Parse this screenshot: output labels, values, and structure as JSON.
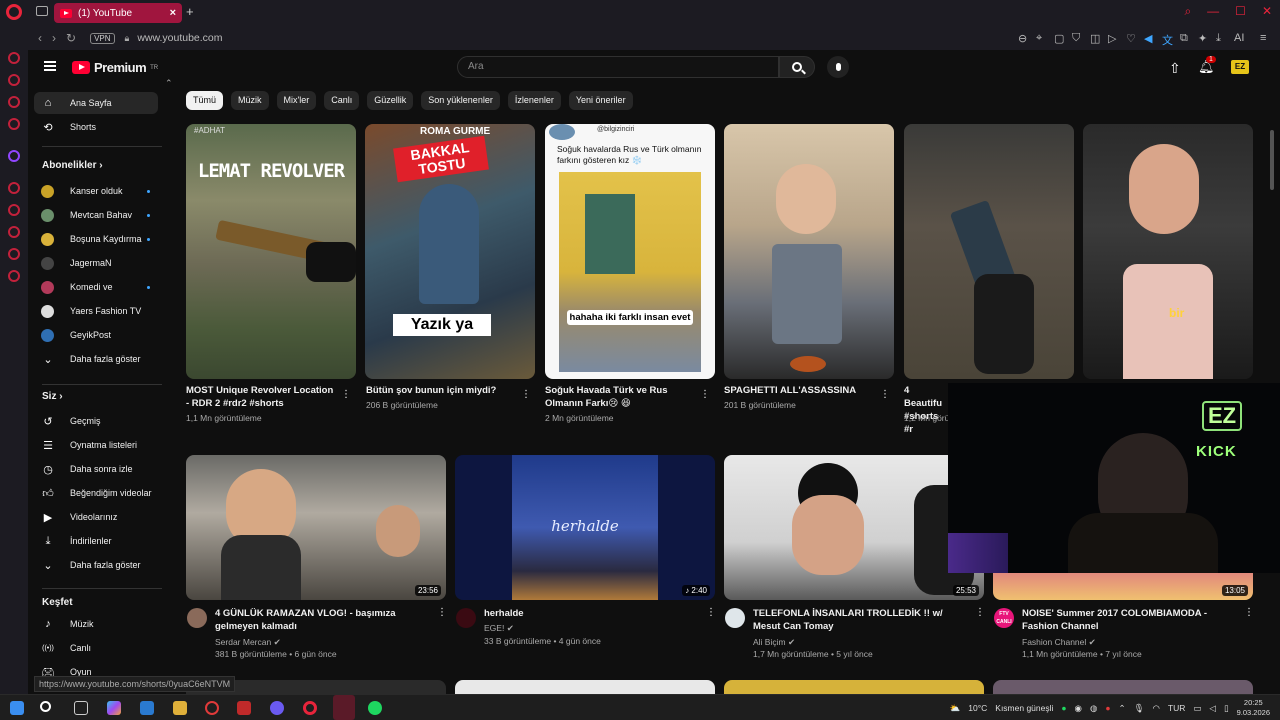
{
  "browser": {
    "tab_title": "(1) YouTube",
    "new_tab": "+",
    "vpn": "VPN",
    "url": "www.youtube.com"
  },
  "header": {
    "logo_text": "Premium",
    "logo_sup": "TR",
    "search_placeholder": "Ara",
    "notification_count": "1",
    "avatar_text": "EZ"
  },
  "sidebar": {
    "main": [
      {
        "label": "Ana Sayfa",
        "icon": "home-icon"
      },
      {
        "label": "Shorts",
        "icon": "shorts-icon"
      }
    ],
    "subscriptions_title": "Abonelikler",
    "subscriptions": [
      {
        "label": "Kanser olduk",
        "dot": true,
        "color": "#c9a227"
      },
      {
        "label": "Mevtcan Bahav",
        "dot": true,
        "color": "#6a8f6b"
      },
      {
        "label": "Boşuna Kaydırma",
        "dot": true,
        "color": "#d9b23a"
      },
      {
        "label": "JagermaN",
        "dot": false,
        "color": "#444444"
      },
      {
        "label": "Komedi ve",
        "dot": true,
        "color": "#b23a5a"
      },
      {
        "label": "Yaers Fashion TV",
        "dot": false,
        "color": "#dddddd"
      },
      {
        "label": "GeyikPost",
        "dot": false,
        "color": "#2f6fb3"
      },
      {
        "label": "Daha fazla göster",
        "dot": false,
        "color": ""
      }
    ],
    "you_title": "Siz",
    "you_items": [
      {
        "label": "Geçmiş",
        "icon": "history-icon"
      },
      {
        "label": "Oynatma listeleri",
        "icon": "playlist-icon"
      },
      {
        "label": "Daha sonra izle",
        "icon": "clock-icon"
      },
      {
        "label": "Beğendiğim videolar",
        "icon": "thumbs-up-icon"
      },
      {
        "label": "Videolarınız",
        "icon": "video-icon"
      },
      {
        "label": "İndirilenler",
        "icon": "download-icon"
      },
      {
        "label": "Daha fazla göster",
        "icon": "chevron-down-icon"
      }
    ],
    "explore_title": "Keşfet",
    "explore_items": [
      {
        "label": "Müzik",
        "icon": "music-icon"
      },
      {
        "label": "Canlı",
        "icon": "live-icon"
      },
      {
        "label": "Oyun",
        "icon": "gaming-icon"
      }
    ]
  },
  "chips": [
    "Tümü",
    "Müzik",
    "Mix'ler",
    "Canlı",
    "Güzellik",
    "Son yüklenenler",
    "İzlenenler",
    "Yeni öneriler"
  ],
  "shorts": [
    {
      "title": "MOST Unique Revolver Location - RDR 2 #rdr2 #shorts",
      "views": "1,1 Mn görüntüleme",
      "overlay": "LEMAT REVOLVER",
      "tag": "#ADHAT"
    },
    {
      "title": "Bütün şov bunun için miydi?",
      "views": "206 B görüntüleme",
      "overlay": "Yazık ya",
      "badge": "BAKKAL TOSTU",
      "top": "ROMA GURME"
    },
    {
      "title": "Soğuk Havada Türk ve Rus Olmanın Farkı😢 😆",
      "views": "2 Mn görüntüleme",
      "handle": "@bilgizinciri",
      "caption": "Soğuk havalarda Rus ve Türk olmanın farkını gösteren kız ❄️",
      "sub": "hahaha iki farklı insan evet"
    },
    {
      "title": "SPAGHETTI ALL'ASSASSINA",
      "views": "201 B görüntüleme"
    },
    {
      "title": "4 Beautifu #shorts #r",
      "views": "1,2 Mn görüntüleme"
    },
    {
      "title": "",
      "views": "",
      "overlay": "bir"
    }
  ],
  "videos": [
    {
      "title": "4 GÜNLÜK RAMAZAN VLOG! - başımıza gelmeyen kalmadı",
      "channel": "Serdar Mercan",
      "meta": "381 B görüntüleme • 6 gün önce",
      "duration": "23:56"
    },
    {
      "title": "herhalde",
      "channel": "EGE!",
      "meta": "33 B görüntüleme • 4 gün önce",
      "duration": "2:40",
      "overlay": "herhalde"
    },
    {
      "title": "TELEFONLA İNSANLARI TROLLEDİK !! w/ Mesut Can Tomay",
      "channel": "Ali Biçim",
      "meta": "1,7 Mn görüntüleme • 5 yıl önce",
      "duration": "25:53"
    },
    {
      "title": "NOISE' Summer 2017 COLOMBIAMODA - Fashion Channel",
      "channel": "Fashion Channel",
      "meta": "1,1 Mn görüntüleme • 7 yıl önce",
      "duration": "13:05",
      "avatar_text": "FTV CANLI"
    }
  ],
  "webcam": {
    "sign": "EZ",
    "sign2": "KICK"
  },
  "status_url": "https://www.youtube.com/shorts/0yuaC6eNTVM",
  "taskbar": {
    "weather": "10°C",
    "weather_desc": "Kısmen güneşli",
    "lang": "TUR",
    "time": "20:25",
    "date": "9.03.2026"
  }
}
